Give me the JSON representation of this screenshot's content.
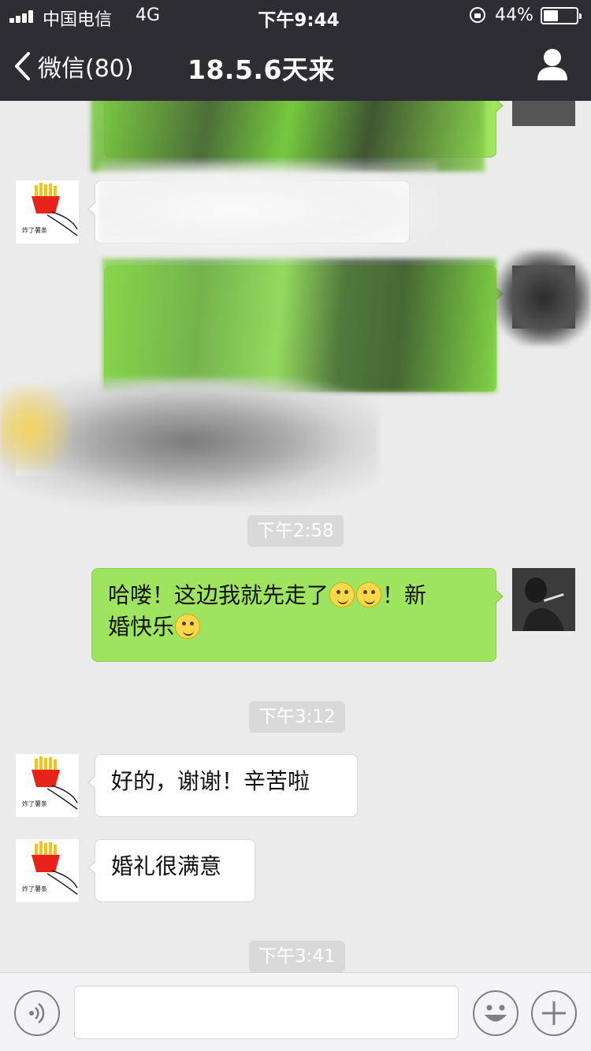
{
  "status_bar": {
    "carrier": "中国电信",
    "network": "4G",
    "time": "下午9:44",
    "battery": "44%"
  },
  "nav": {
    "back_label": "微信(80)",
    "title": "18.5.6天来"
  },
  "timestamps": [
    "下午2:58",
    "下午3:12",
    "下午3:41"
  ],
  "messages": {
    "sent_1": {
      "line1": "哈喽！这边我就先走了",
      "line1_tail": "！新",
      "line2": "婚快乐"
    },
    "recv_1": "好的，谢谢！辛苦啦",
    "recv_2": "婚礼很满意"
  },
  "avatars": {
    "fries_label": "炸了薯条"
  },
  "input": {
    "placeholder": ""
  },
  "colors": {
    "titlebar": "#2e2e32",
    "chat_bg": "#ebebeb",
    "sent_bubble": "#9fe45e",
    "recv_bubble": "#ffffff"
  }
}
